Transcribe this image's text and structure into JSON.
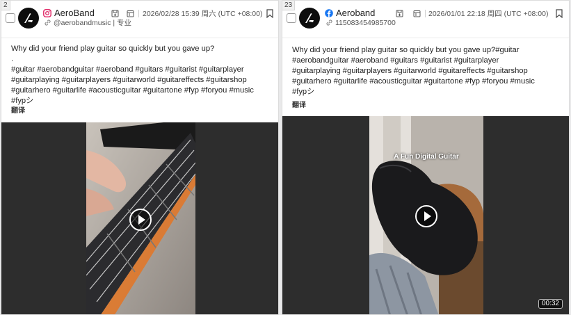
{
  "posts": [
    {
      "index": "2",
      "platform": "instagram-icon",
      "account_name": "AeroBand",
      "handle": "@aerobandmusic | 专业",
      "timestamp": "2026/02/28 15:39 周六 (UTC +08:00)",
      "text": "Why did your friend play guitar so quickly but you gave up?\n.\n#guitar #aerobandguitar #aeroband #guitars #guitarist #guitarplayer\n#guitarplaying #guitarplayers #guitarworld #guitareffects #guitarshop\n#guitarhero #guitarlife #acousticguitar #guitartone #fyp #foryou #music\n#fypシ",
      "translate_label": "翻译",
      "media_overlay": "",
      "duration": ""
    },
    {
      "index": "23",
      "platform": "facebook-icon",
      "account_name": "Aeroband",
      "handle": "115083454985700",
      "timestamp": "2026/01/01 22:18 周四 (UTC +08:00)",
      "text": "Why did your friend play guitar so quickly but you gave up?#guitar\n#aerobandguitar #aeroband #guitars #guitarist #guitarplayer\n#guitarplaying #guitarplayers #guitarworld #guitareffects #guitarshop\n#guitarhero #guitarlife #acousticguitar #guitartone #fyp #foryou #music\n#fypシ",
      "translate_label": "翻译",
      "media_overlay": "A Fun Digital Guitar",
      "duration": "00:32"
    }
  ],
  "colors": {
    "instagram": "#e1306c",
    "facebook": "#1877f2",
    "media_bg": "#2d2d2d"
  }
}
